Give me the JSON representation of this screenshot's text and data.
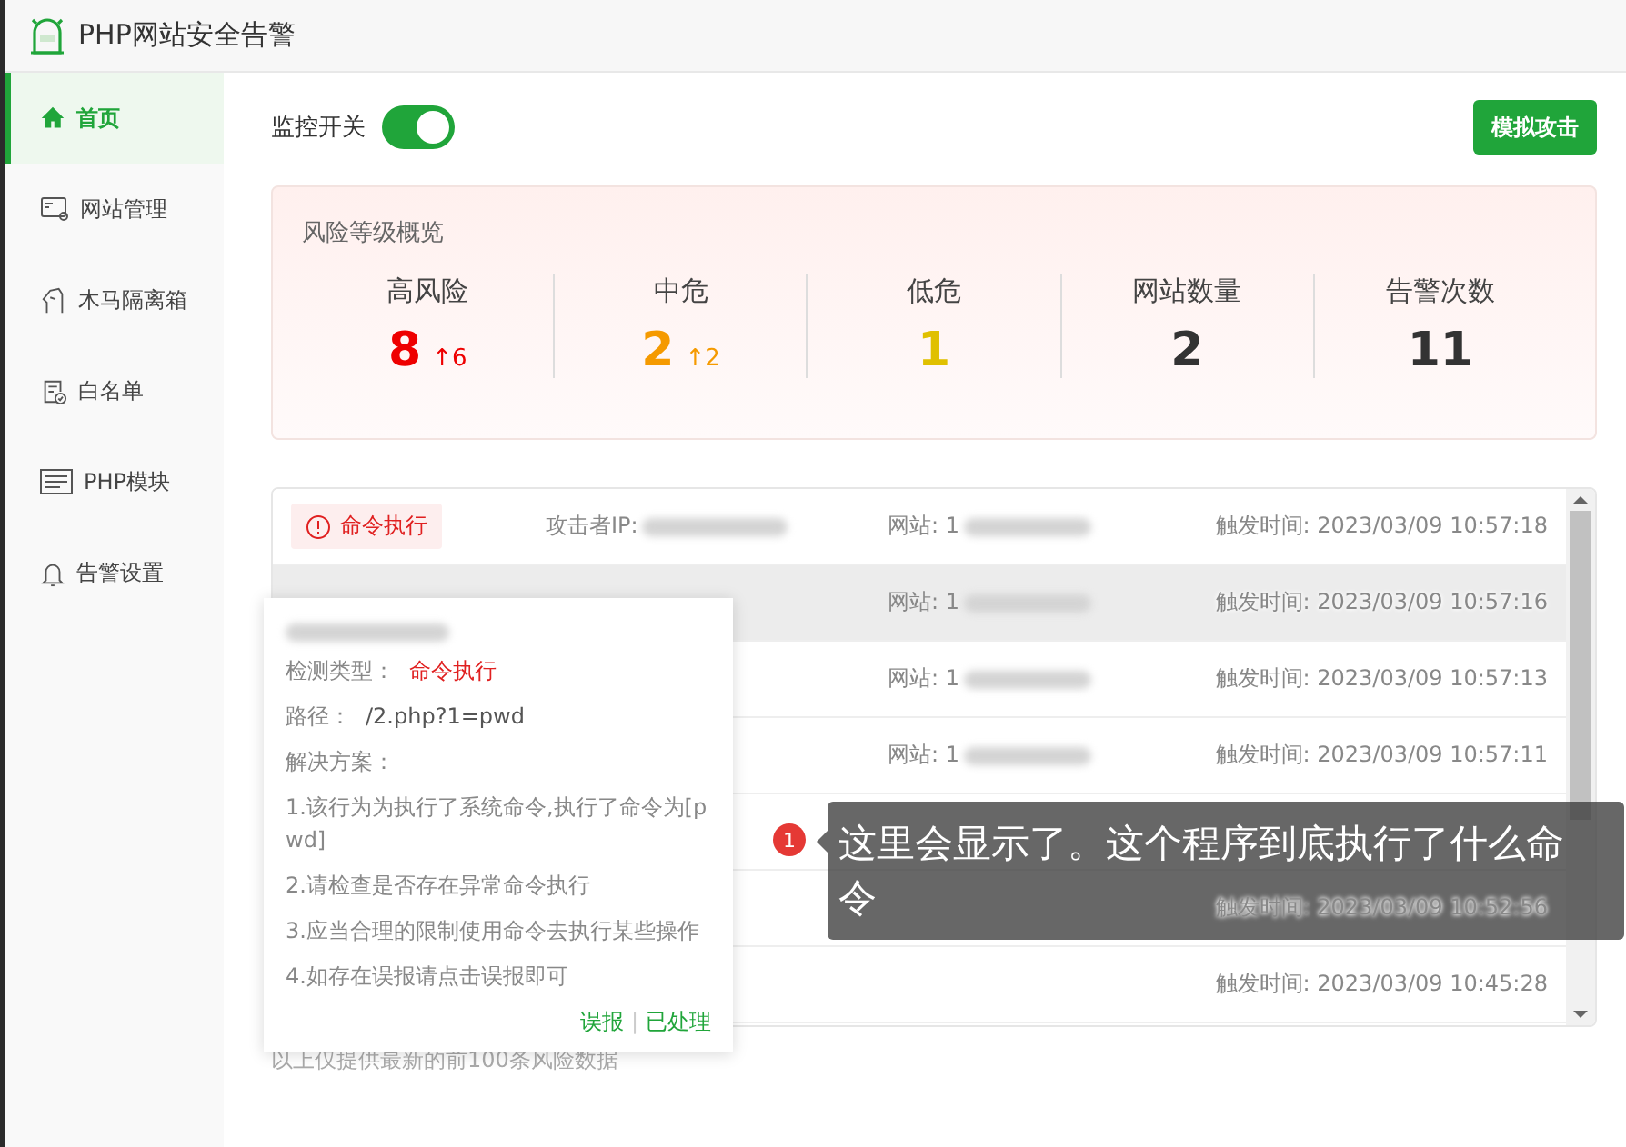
{
  "window": {
    "title": "PHP网站安全告警"
  },
  "sidebar": {
    "items": [
      {
        "label": "首页",
        "selected": true
      },
      {
        "label": "网站管理",
        "selected": false
      },
      {
        "label": "木马隔离箱",
        "selected": false
      },
      {
        "label": "白名单",
        "selected": false
      },
      {
        "label": "PHP模块",
        "selected": false
      },
      {
        "label": "告警设置",
        "selected": false
      }
    ]
  },
  "monitor": {
    "label": "监控开关",
    "on": true
  },
  "simulate_button": "模拟攻击",
  "overview": {
    "title": "风险等级概览",
    "stats": [
      {
        "label": "高风险",
        "value": "8",
        "delta": "↑6",
        "color": "#ee0000"
      },
      {
        "label": "中危",
        "value": "2",
        "delta": "↑2",
        "color": "#f59a00"
      },
      {
        "label": "低危",
        "value": "1",
        "color": "#e0c000"
      },
      {
        "label": "网站数量",
        "value": "2",
        "color": "#333333"
      },
      {
        "label": "告警次数",
        "value": "11",
        "color": "#333333"
      }
    ]
  },
  "alerts": [
    {
      "tag": "命令执行",
      "ip_label": "攻击者IP:",
      "site_label": "网站: 1",
      "time": "触发时间: 2023/03/09 10:57:18",
      "selected": false
    },
    {
      "site_label": "网站: 1",
      "time": "触发时间: 2023/03/09 10:57:16",
      "selected": true
    },
    {
      "site_label": "网站: 1",
      "time": "触发时间: 2023/03/09 10:57:13",
      "selected": false
    },
    {
      "site_label": "网站: 1",
      "time": "触发时间: 2023/03/09 10:57:11",
      "selected": false
    },
    {
      "selected": false
    },
    {
      "time": "触发时间: 2023/03/09 10:52:56",
      "selected": false
    },
    {
      "time": "触发时间: 2023/03/09 10:45:28",
      "selected": false
    }
  ],
  "footer_note": "以上仅提供最新的前100条风险数据",
  "popover": {
    "type_label": "检测类型：",
    "type_value": "命令执行",
    "path_label": "路径：",
    "path_value": "/2.php?1=pwd",
    "solution_label": "解决方案：",
    "solutions": [
      "1.该行为为执行了系统命令,执行了命令为[pwd]",
      "2.请检查是否存在异常命令执行",
      "3.应当合理的限制使用命令去执行某些操作",
      "4.如存在误报请点击误报即可"
    ],
    "actions": [
      "误报",
      "已处理"
    ],
    "separator": "|"
  },
  "annotation": {
    "badge": "1",
    "text": "这里会显示了。这个程序到底执行了什么命令"
  }
}
